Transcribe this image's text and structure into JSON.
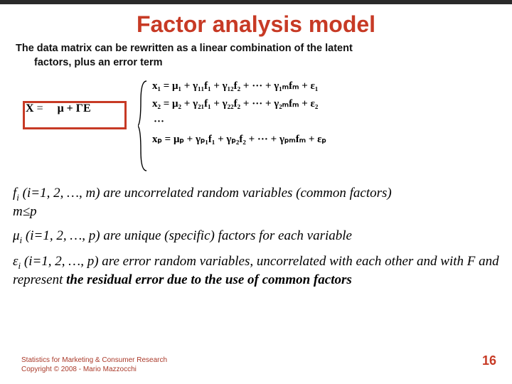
{
  "title": "Factor analysis model",
  "intro_line1": "The data matrix can be rewritten as a linear combination of the latent",
  "intro_line2": "factors, plus an error term",
  "lhs": {
    "X": "X",
    "eq": "=",
    "mu": "μ",
    "plus": "+",
    "Gamma": "Γ",
    "E": "E"
  },
  "rhs": {
    "r1": "x₁ = μ₁ + γ₁₁f₁ + γ₁₂f₂ + ··· + γ₁ₘfₘ + ε₁",
    "r2": "x₂ = μ₂ + γ₂₁f₁ + γ₂₂f₂ + ··· + γ₂ₘfₘ + ε₂",
    "dots": "···",
    "rp": "xₚ = μₚ + γₚ₁f₁ + γₚ₂f₂ + ··· + γₚₘfₘ + εₚ"
  },
  "desc1_pre": "f",
  "desc1_sub": "i",
  "desc1_rest": " (i=1, 2, …, m) are uncorrelated random variables (common factors)",
  "desc1b": "m≤p",
  "desc2_pre": "μ",
  "desc2_sub": "i",
  "desc2_rest": " (i=1, 2, …, p) are unique (specific) factors for each variable",
  "desc3_pre": "ε",
  "desc3_sub": "i",
  "desc3_rest": " (i=1, 2, …, p) are error random variables, uncorrelated with each other and with F and represent ",
  "desc3_bold": "the residual error due to the use of common factors",
  "footer1": "Statistics for Marketing & Consumer Research",
  "footer2": "Copyright © 2008 - Mario Mazzocchi",
  "pagenum": "16"
}
